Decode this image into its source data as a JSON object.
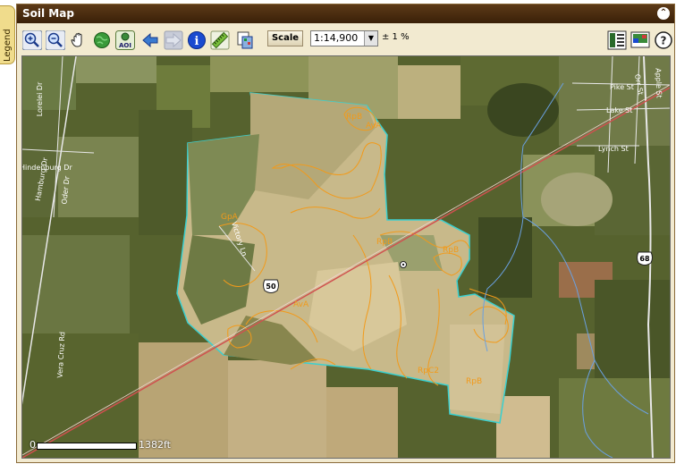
{
  "legend_tab": {
    "label": "Legend"
  },
  "window": {
    "title": "Soil Map",
    "collapse_icon": "⌃"
  },
  "toolbar": {
    "tools": [
      {
        "name": "zoom-in-icon",
        "label": "Zoom In"
      },
      {
        "name": "zoom-out-icon",
        "label": "Zoom Out"
      },
      {
        "name": "pan-hand-icon",
        "label": "Pan"
      },
      {
        "name": "full-extent-globe-icon",
        "label": "Full Extent"
      },
      {
        "name": "zoom-aoi-icon",
        "label": "AOI"
      },
      {
        "name": "back-arrow-icon",
        "label": "Previous Extent"
      },
      {
        "name": "forward-arrow-icon",
        "label": "Next Extent"
      },
      {
        "name": "identify-info-icon",
        "label": "Identify"
      },
      {
        "name": "measure-ruler-icon",
        "label": "Measure"
      },
      {
        "name": "clear-selection-icon",
        "label": "Clear"
      }
    ],
    "aoi_text": "AOI",
    "info_text": "i",
    "scale_button": "Scale",
    "scale_value": "1:14,900",
    "accuracy": "± 1 %",
    "right_tools": [
      {
        "name": "legend-layout-icon"
      },
      {
        "name": "print-map-icon"
      },
      {
        "name": "help-icon",
        "text": "?"
      }
    ]
  },
  "map": {
    "scalebar": {
      "start": "0",
      "end": "1382ft"
    },
    "soil_labels": {
      "rpb_1": "RpB",
      "ava_1": "AvA",
      "gpa": "GpA",
      "rpb_2": "RpB",
      "rpb_3": "RpB",
      "ava_2": "AvA",
      "rpc2": "RpC2",
      "rpb_4": "RpB"
    },
    "streets": {
      "lorelei": "Lorelei Dr",
      "hamburg": "Hamburg Dr",
      "hindenburg": "Hindenburg Dr",
      "oder": "Oder Dr",
      "vera_cruz": "Vera Cruz Rd",
      "victory": "Victory Ln",
      "pike": "Pike St",
      "lake": "Lake St",
      "lynch": "Lynch St",
      "orr": "Orr St",
      "apple": "Apple St"
    },
    "shields": {
      "us50": "50",
      "us68": "68"
    },
    "colors": {
      "aoi_boundary": "#3ad0d0",
      "soil_lines": "#f29a1a",
      "highway": "#d05050",
      "stream": "#6aa0e0"
    }
  }
}
